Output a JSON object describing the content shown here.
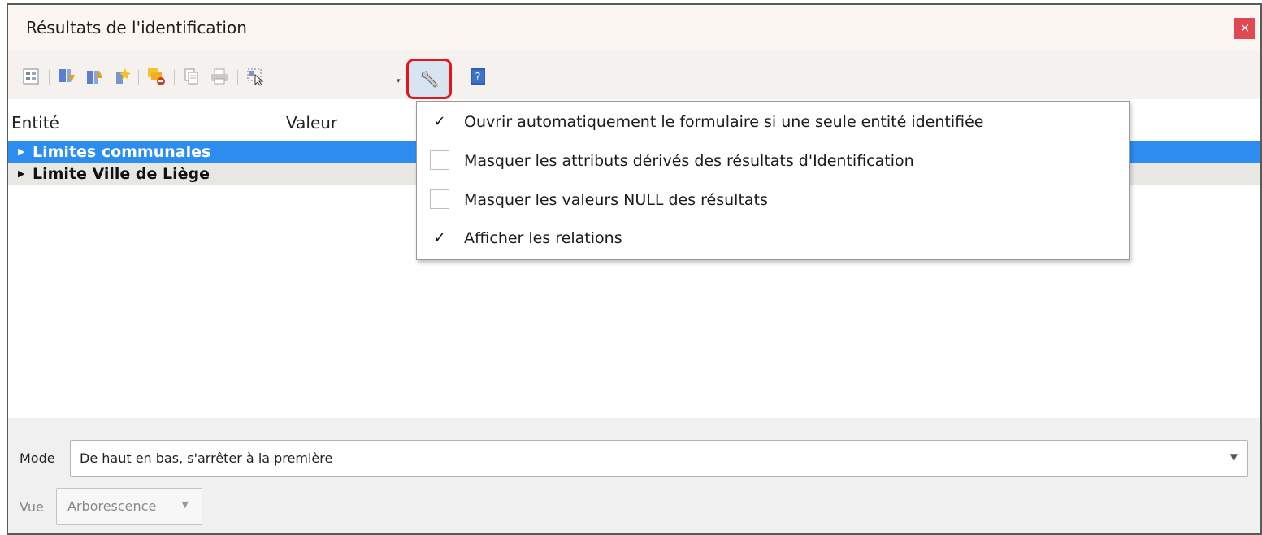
{
  "window": {
    "title": "Résultats de l'identification",
    "close_glyph": "×"
  },
  "toolbar": {
    "icons": [
      "expand-tree-icon",
      "expand-new-results-icon",
      "collapse-icon",
      "select-features-icon",
      "clear-results-icon",
      "copy-icon",
      "print-icon",
      "identify-select-icon",
      "settings-wrench-icon",
      "help-icon"
    ],
    "dropdown_glyph": "▾"
  },
  "columns": {
    "entity": "Entité",
    "value": "Valeur"
  },
  "tree": {
    "rows": [
      {
        "label": "Limites communales",
        "selected": true,
        "arrow": "▶"
      },
      {
        "label": "Limite Ville de Liège",
        "selected": false,
        "arrow": "▶"
      }
    ]
  },
  "mode": {
    "label": "Mode",
    "value": "De haut en bas, s'arrêter à la première",
    "dropdown_glyph": "▼"
  },
  "view": {
    "label": "Vue",
    "value": "Arborescence",
    "dropdown_glyph": "▼"
  },
  "settings_menu": {
    "items": [
      {
        "label": "Ouvrir automatiquement le formulaire si une seule entité identifiée",
        "checked": true,
        "mark": "✓"
      },
      {
        "label": "Masquer les attributs dérivés des résultats d'Identification",
        "checked": false,
        "mark": ""
      },
      {
        "label": "Masquer les valeurs NULL des résultats",
        "checked": false,
        "mark": ""
      },
      {
        "label": "Afficher les relations",
        "checked": true,
        "mark": "✓"
      }
    ]
  },
  "colors": {
    "selection": "#2d8cf0",
    "highlight_border": "#e8141c",
    "close": "#e04853"
  }
}
